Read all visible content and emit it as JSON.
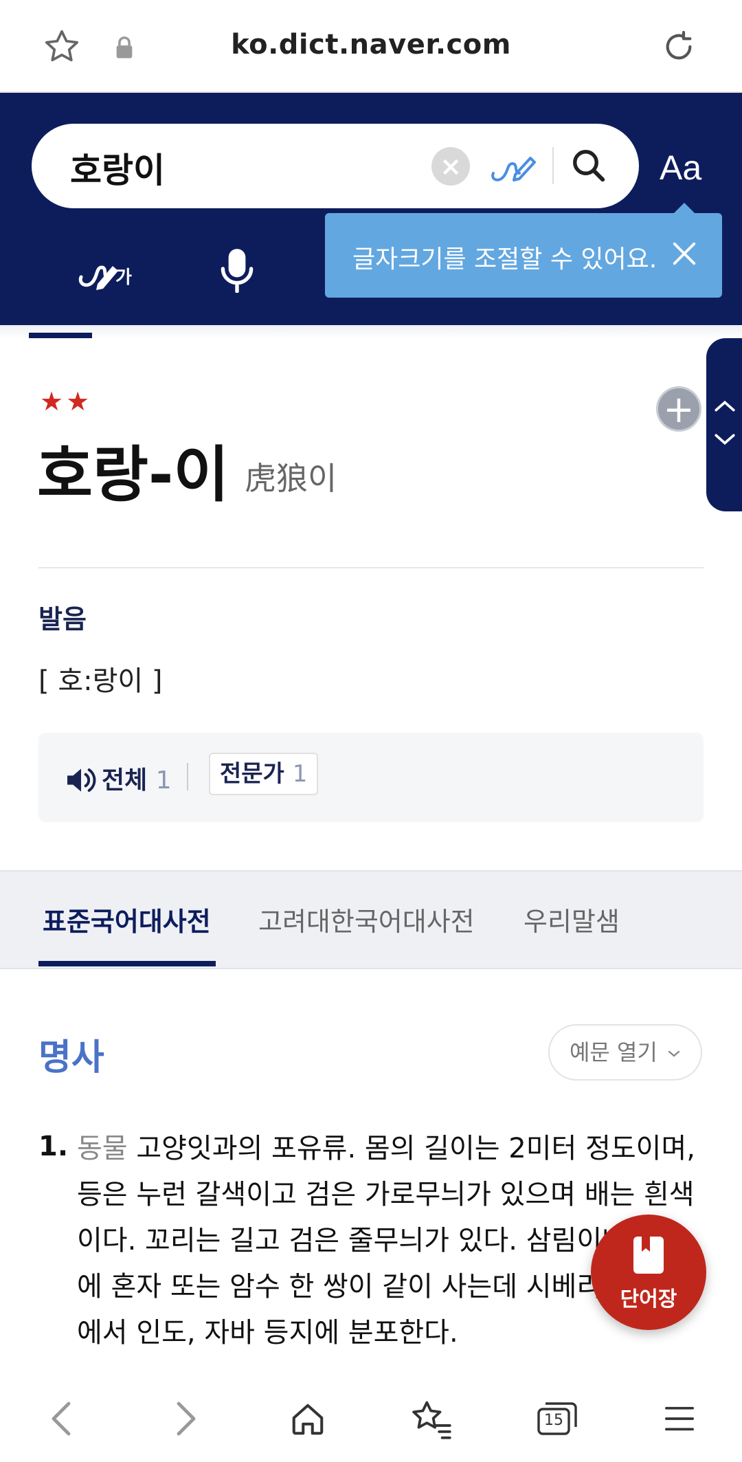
{
  "browser": {
    "url": "ko.dict.naver.com",
    "tab_count": "15"
  },
  "search": {
    "query": "호랑이",
    "font_size_label": "Aa",
    "tooltip": "글자크기를 조절할 수 있어요.",
    "handwriting_badge": "가"
  },
  "entry": {
    "stars": "★★",
    "headword": "호랑-이",
    "hanja": "虎狼이",
    "pronunciation_title": "발음",
    "pronunciation": "[ 호:랑이 ]",
    "audio_all_label": "전체",
    "audio_all_count": "1",
    "expert_label": "전문가",
    "expert_count": "1"
  },
  "dict_tabs": [
    {
      "label": "표준국어대사전"
    },
    {
      "label": "고려대한국어대사전"
    },
    {
      "label": "우리말샘"
    }
  ],
  "definition": {
    "pos": "명사",
    "example_toggle": "예문 열기",
    "number": "1.",
    "category": "동물",
    "text": "고양잇과의 포유류. 몸의 길이는 2미터 정도이며, 등은 누런 갈색이고 검은 가로무늬가 있으며 배는 흰색이다. 꼬리는 길고 검은 줄무늬가 있다. 삼림이나 산지에 혼자 또는 암수 한 쌍이 같이 사는데 시베리아, 중국에서 인도, 자바 등지에 분포한다."
  },
  "fab": {
    "label": "단어장"
  },
  "colors": {
    "header": "#0d1d5c",
    "tooltip": "#63a7e0",
    "fab": "#c0271c",
    "pos": "#4a72c7",
    "stars": "#d0291f"
  }
}
